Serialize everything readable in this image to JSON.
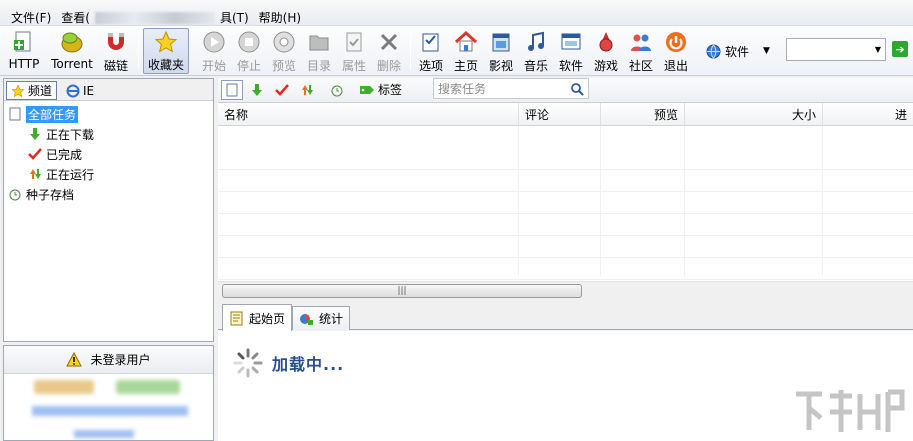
{
  "menu": {
    "file": "文件(F)",
    "view": "查看(",
    "tools": "具(T)",
    "help": "帮助(H)"
  },
  "toolbar": {
    "http": "HTTP",
    "torrent": "Torrent",
    "magnet": "磁链",
    "favorites": "收藏夹",
    "start": "开始",
    "stop": "停止",
    "preview": "预览",
    "directory": "目录",
    "properties": "属性",
    "delete": "删除",
    "options": "选项",
    "home": "主页",
    "video": "影视",
    "music": "音乐",
    "software": "软件",
    "games": "游戏",
    "community": "社区",
    "exit": "退出",
    "category_selected": "软件",
    "search_value": ""
  },
  "left_tabs": {
    "channel": "频道",
    "ie": "IE"
  },
  "tree": {
    "all_tasks": "全部任务",
    "downloading": "正在下载",
    "completed": "已完成",
    "running": "正在运行",
    "seed_archive": "种子存档"
  },
  "user": {
    "not_logged_in": "未登录用户"
  },
  "task_toolbar": {
    "tags": "标签",
    "search_placeholder": "搜索任务"
  },
  "grid": {
    "columns": [
      "名称",
      "评论",
      "预览",
      "大小",
      "进"
    ]
  },
  "bottom_tabs": {
    "start_page": "起始页",
    "stats": "统计"
  },
  "loading_text": "加载中...",
  "colors": {
    "selection": "#3399ff",
    "loading_text": "#2a4f86",
    "exit_orange": "#f36b1b"
  }
}
